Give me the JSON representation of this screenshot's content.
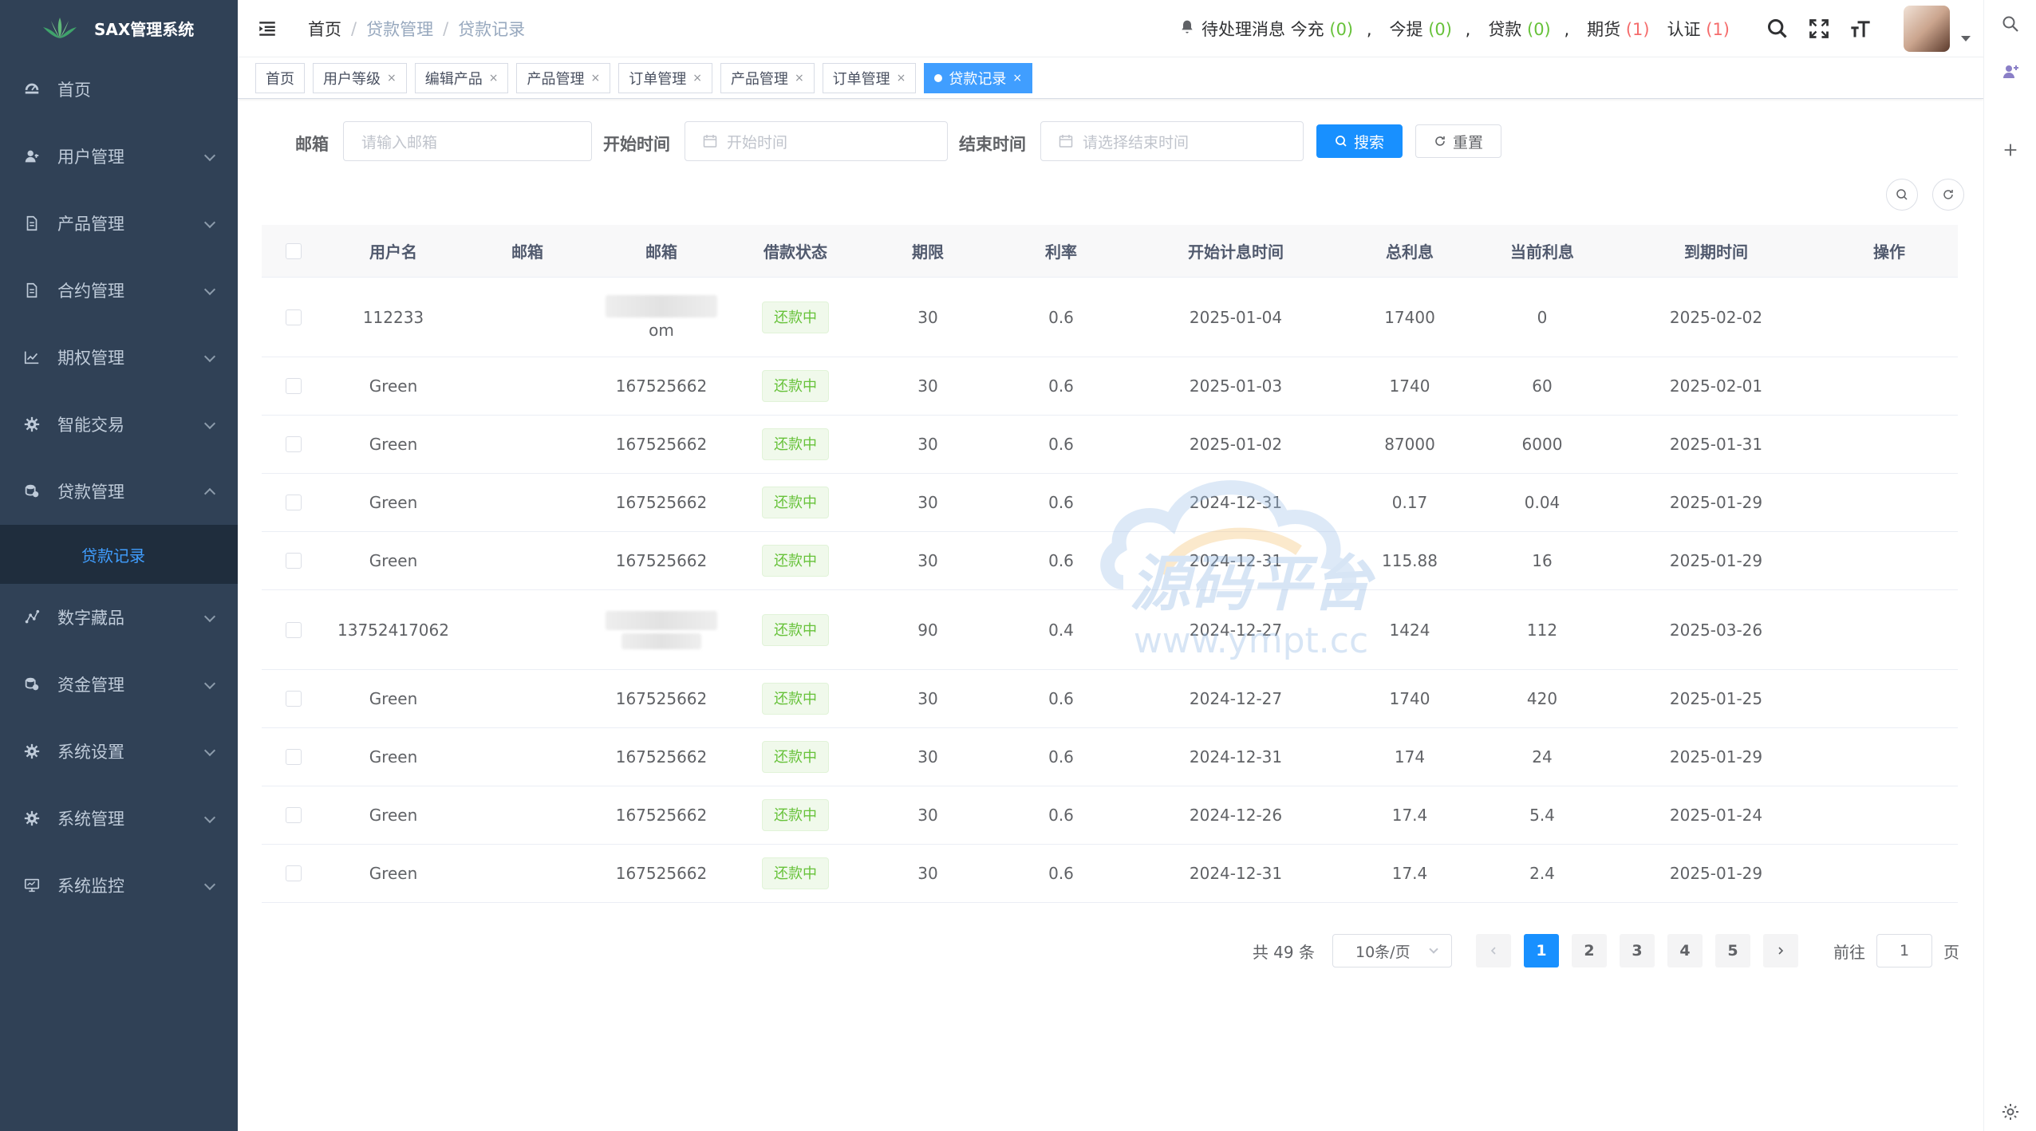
{
  "app": {
    "title": "SAX管理系统"
  },
  "sidebar": {
    "items": [
      {
        "label": "首页",
        "icon": "dashboard-icon",
        "expandable": false
      },
      {
        "label": "用户管理",
        "icon": "user-icon",
        "expandable": true
      },
      {
        "label": "产品管理",
        "icon": "document-icon",
        "expandable": true
      },
      {
        "label": "合约管理",
        "icon": "document-icon",
        "expandable": true
      },
      {
        "label": "期权管理",
        "icon": "chart-icon",
        "expandable": true
      },
      {
        "label": "智能交易",
        "icon": "gear-icon",
        "expandable": true
      },
      {
        "label": "贷款管理",
        "icon": "money-icon",
        "expandable": true,
        "expanded": true
      },
      {
        "label": "数字藏品",
        "icon": "graph-icon",
        "expandable": true
      },
      {
        "label": "资金管理",
        "icon": "money-icon",
        "expandable": true
      },
      {
        "label": "系统设置",
        "icon": "gear-icon",
        "expandable": true
      },
      {
        "label": "系统管理",
        "icon": "gear-icon",
        "expandable": true
      },
      {
        "label": "系统监控",
        "icon": "monitor-icon",
        "expandable": true
      }
    ],
    "active_sub": "贷款记录"
  },
  "navbar": {
    "breadcrumb": [
      "首页",
      "贷款管理",
      "贷款记录"
    ],
    "messages": [
      {
        "label": "待处理消息 今充",
        "count": "(0)",
        "color": "green"
      },
      {
        "label": "今提",
        "count": "(0)",
        "color": "green"
      },
      {
        "label": "贷款",
        "count": "(0)",
        "color": "green"
      },
      {
        "label": "期货",
        "count": "(1)",
        "color": "red"
      },
      {
        "label": "认证",
        "count": "(1)",
        "color": "red"
      }
    ],
    "separator": ","
  },
  "tags": [
    {
      "label": "首页",
      "closable": false
    },
    {
      "label": "用户等级",
      "closable": true
    },
    {
      "label": "编辑产品",
      "closable": true
    },
    {
      "label": "产品管理",
      "closable": true
    },
    {
      "label": "订单管理",
      "closable": true
    },
    {
      "label": "产品管理",
      "closable": true
    },
    {
      "label": "订单管理",
      "closable": true
    },
    {
      "label": "贷款记录",
      "closable": true,
      "active": true
    }
  ],
  "search": {
    "email_label": "邮箱",
    "email_placeholder": "请输入邮箱",
    "start_label": "开始时间",
    "start_placeholder": "开始时间",
    "end_label": "结束时间",
    "end_placeholder": "请选择结束时间",
    "search_button": "搜索",
    "reset_button": "重置"
  },
  "table": {
    "columns": [
      "用户名",
      "邮箱",
      "邮箱",
      "借款状态",
      "期限",
      "利率",
      "开始计息时间",
      "总利息",
      "当前利息",
      "到期时间",
      "操作"
    ],
    "rows": [
      {
        "user": "112233",
        "email": "om",
        "status": "还款中",
        "term": "30",
        "rate": "0.6",
        "start": "2025-01-04",
        "total": "17400",
        "current": "0",
        "end": "2025-02-02",
        "tall": true,
        "masked": "top"
      },
      {
        "user": "Green",
        "email": "167525662",
        "status": "还款中",
        "term": "30",
        "rate": "0.6",
        "start": "2025-01-03",
        "total": "1740",
        "current": "60",
        "end": "2025-02-01"
      },
      {
        "user": "Green",
        "email": "167525662",
        "status": "还款中",
        "term": "30",
        "rate": "0.6",
        "start": "2025-01-02",
        "total": "87000",
        "current": "6000",
        "end": "2025-01-31"
      },
      {
        "user": "Green",
        "email": "167525662",
        "status": "还款中",
        "term": "30",
        "rate": "0.6",
        "start": "2024-12-31",
        "total": "0.17",
        "current": "0.04",
        "end": "2025-01-29"
      },
      {
        "user": "Green",
        "email": "167525662",
        "status": "还款中",
        "term": "30",
        "rate": "0.6",
        "start": "2024-12-31",
        "total": "115.88",
        "current": "16",
        "end": "2025-01-29"
      },
      {
        "user": "13752417062",
        "email": "",
        "status": "还款中",
        "term": "90",
        "rate": "0.4",
        "start": "2024-12-27",
        "total": "1424",
        "current": "112",
        "end": "2025-03-26",
        "tall": true,
        "masked": "full"
      },
      {
        "user": "Green",
        "email": "167525662",
        "status": "还款中",
        "term": "30",
        "rate": "0.6",
        "start": "2024-12-27",
        "total": "1740",
        "current": "420",
        "end": "2025-01-25"
      },
      {
        "user": "Green",
        "email": "167525662",
        "status": "还款中",
        "term": "30",
        "rate": "0.6",
        "start": "2024-12-31",
        "total": "174",
        "current": "24",
        "end": "2025-01-29"
      },
      {
        "user": "Green",
        "email": "167525662",
        "status": "还款中",
        "term": "30",
        "rate": "0.6",
        "start": "2024-12-26",
        "total": "17.4",
        "current": "5.4",
        "end": "2025-01-24"
      },
      {
        "user": "Green",
        "email": "167525662",
        "status": "还款中",
        "term": "30",
        "rate": "0.6",
        "start": "2024-12-31",
        "total": "17.4",
        "current": "2.4",
        "end": "2025-01-29"
      }
    ]
  },
  "pagination": {
    "total_text": "共 49 条",
    "page_size": "10条/页",
    "pages": [
      "1",
      "2",
      "3",
      "4",
      "5"
    ],
    "current": "1",
    "goto_prefix": "前往",
    "goto_value": "1",
    "goto_suffix": "页"
  },
  "watermark": {
    "title": "源码平台",
    "url": "www.ympt.cc"
  },
  "colors": {
    "sidebar_bg": "#304156",
    "primary": "#1890ff",
    "success": "#67c23a",
    "danger": "#f56c6c"
  }
}
